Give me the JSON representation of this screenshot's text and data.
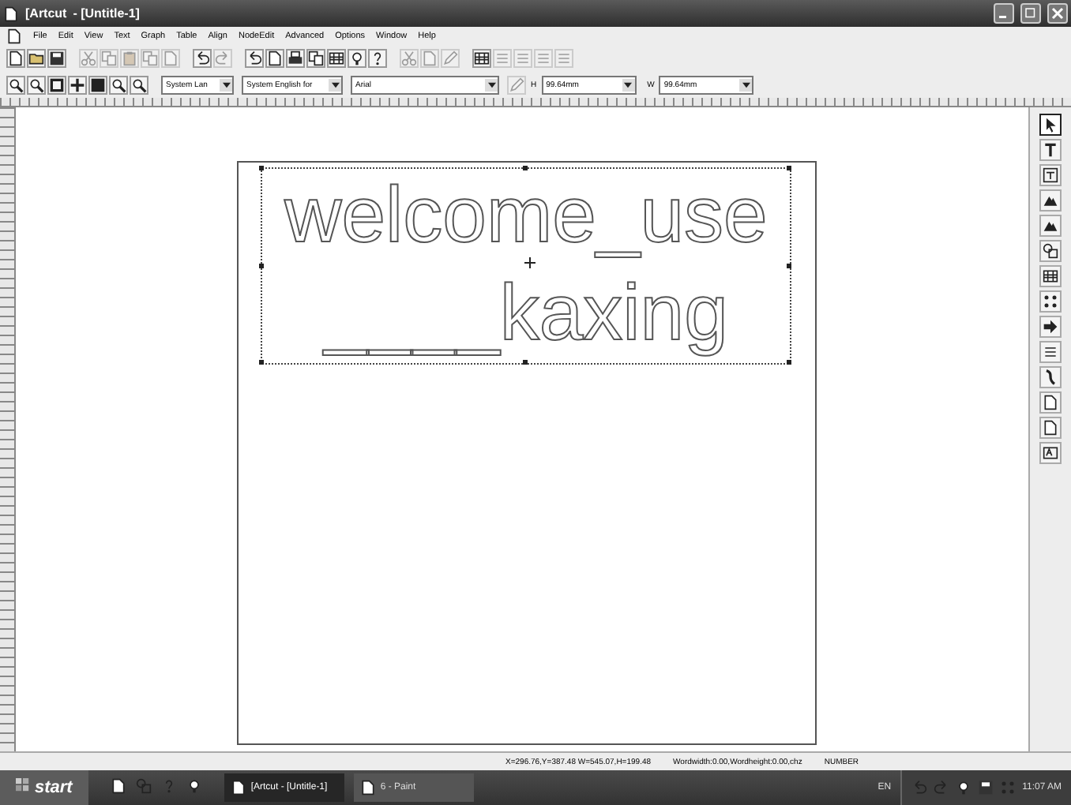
{
  "window": {
    "app_title": "[Artcut",
    "document_title": "- [Untitle-1]"
  },
  "menu": [
    "File",
    "Edit",
    "View",
    "Text",
    "Graph",
    "Table",
    "Align",
    "NodeEdit",
    "Advanced",
    "Options",
    "Window",
    "Help"
  ],
  "toolbar_1": [
    {
      "kind": "page",
      "disabled": false
    },
    {
      "kind": "folder",
      "disabled": false
    },
    {
      "kind": "disk",
      "disabled": false
    },
    {
      "kind": "sep"
    },
    {
      "kind": "scissors",
      "disabled": true
    },
    {
      "kind": "copy",
      "disabled": true
    },
    {
      "kind": "paste",
      "disabled": true
    },
    {
      "kind": "copy",
      "disabled": true
    },
    {
      "kind": "page",
      "disabled": true
    },
    {
      "kind": "sep"
    },
    {
      "kind": "undo",
      "disabled": false
    },
    {
      "kind": "redo",
      "disabled": true
    },
    {
      "kind": "sep"
    },
    {
      "kind": "undo",
      "disabled": false
    },
    {
      "kind": "page",
      "disabled": false
    },
    {
      "kind": "printer",
      "disabled": false
    },
    {
      "kind": "copy",
      "disabled": false
    },
    {
      "kind": "grid",
      "disabled": false
    },
    {
      "kind": "bulb",
      "disabled": false
    },
    {
      "kind": "help",
      "disabled": false
    },
    {
      "kind": "sep"
    },
    {
      "kind": "scissors",
      "disabled": true
    },
    {
      "kind": "page",
      "disabled": true
    },
    {
      "kind": "pen",
      "disabled": true
    },
    {
      "kind": "sep"
    },
    {
      "kind": "grid",
      "disabled": false
    },
    {
      "kind": "bars",
      "disabled": true
    },
    {
      "kind": "bars",
      "disabled": true
    },
    {
      "kind": "bars",
      "disabled": true
    },
    {
      "kind": "bars",
      "disabled": true
    }
  ],
  "toolbar_2": {
    "tools": [
      {
        "kind": "zoom"
      },
      {
        "kind": "zoom"
      },
      {
        "kind": "square"
      },
      {
        "kind": "move"
      },
      {
        "kind": "fill"
      },
      {
        "kind": "zoom"
      },
      {
        "kind": "zoom"
      }
    ],
    "language": "System Lan",
    "encoding": "System English for",
    "font": "Arial",
    "height_label": "H",
    "height": "99.64mm",
    "width_label": "W",
    "width": "99.64mm"
  },
  "canvas": {
    "lines": [
      "welcome_use",
      "____kaxing"
    ]
  },
  "toolbox": [
    {
      "kind": "pointer",
      "selected": true
    },
    {
      "kind": "text",
      "selected": false
    },
    {
      "kind": "frame",
      "selected": false
    },
    {
      "kind": "shape",
      "selected": false
    },
    {
      "kind": "shape",
      "selected": false
    },
    {
      "kind": "shapes",
      "selected": false
    },
    {
      "kind": "grid",
      "selected": false
    },
    {
      "kind": "dots",
      "selected": false
    },
    {
      "kind": "arrow",
      "selected": false
    },
    {
      "kind": "bars",
      "selected": false
    },
    {
      "kind": "curve",
      "selected": false
    },
    {
      "kind": "page",
      "selected": false
    },
    {
      "kind": "page",
      "selected": false
    },
    {
      "kind": "textbox",
      "selected": false
    }
  ],
  "status_bar": {
    "position": "X=296.76,Y=387.48  W=545.07,H=199.48",
    "word_size": "Wordwidth:0.00,Wordheight:0.00,chz",
    "mode": "NUMBER"
  },
  "taskbar": {
    "start": "start",
    "tasks": [
      {
        "label": "[Artcut   - [Untitle-1]",
        "selected": true
      },
      {
        "label": "6 - Paint",
        "selected": false
      }
    ],
    "language": "EN",
    "time": "11:07 AM"
  }
}
